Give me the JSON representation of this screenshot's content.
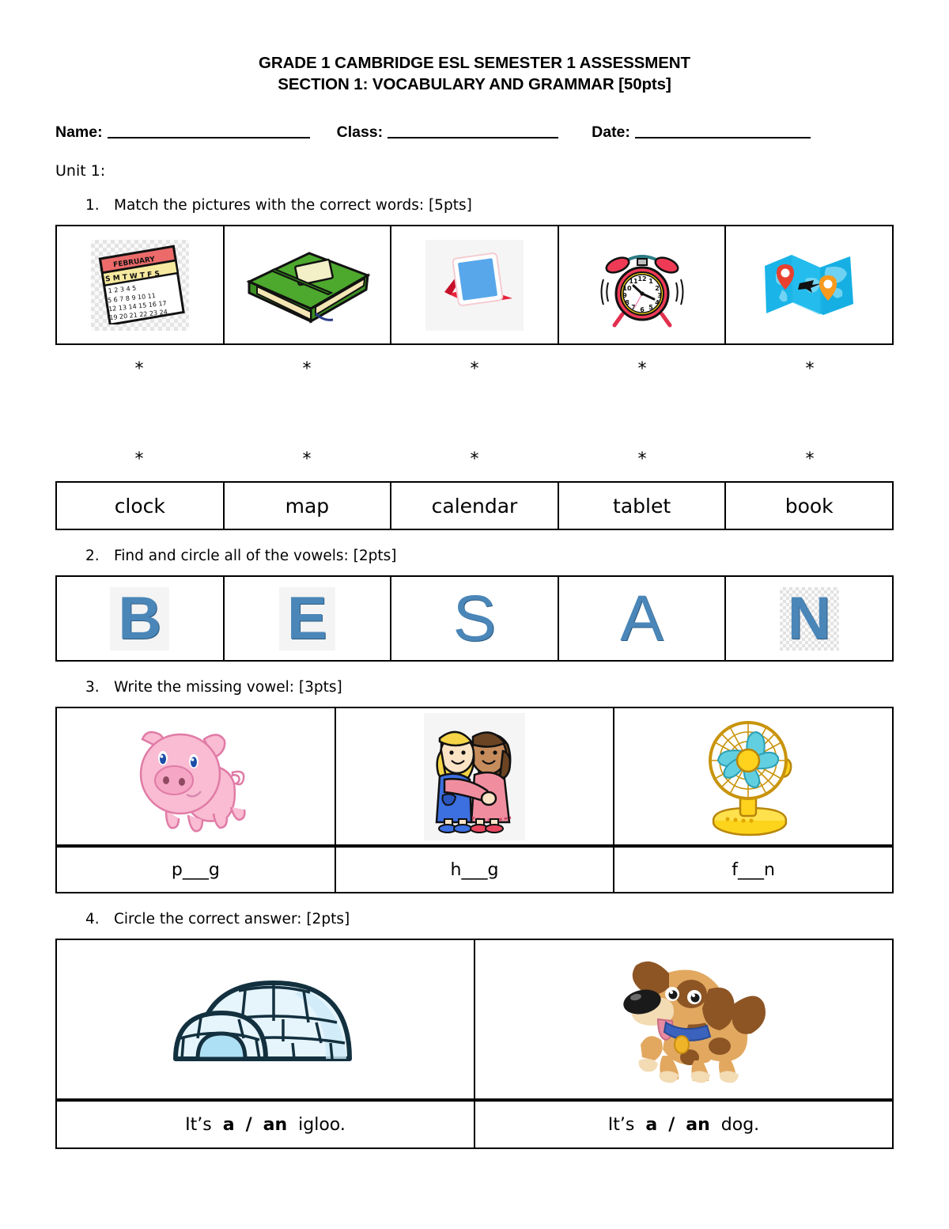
{
  "header": {
    "title_line1": "GRADE 1 CAMBRIDGE ESL SEMESTER 1 ASSESSMENT",
    "title_line2": "SECTION 1: VOCABULARY AND GRAMMAR [50pts]",
    "name_label": "Name:",
    "class_label": "Class:",
    "date_label": "Date:",
    "name_value": "",
    "class_value": "",
    "date_value": ""
  },
  "unit": {
    "label": "Unit 1:"
  },
  "questions": [
    {
      "number": "1.",
      "text": "Match the pictures with the correct words: [5pts]"
    },
    {
      "number": "2.",
      "text": "Find and circle all of the vowels: [2pts]"
    },
    {
      "number": "3.",
      "text": "Write the missing vowel: [3pts]"
    },
    {
      "number": "4.",
      "text": "Circle the correct answer: [2pts]"
    }
  ],
  "q1": {
    "pictures": [
      {
        "icon": "calendar-icon",
        "alt": "calendar",
        "month": "FEBRUARY"
      },
      {
        "icon": "book-icon",
        "alt": "book"
      },
      {
        "icon": "tablet-icon",
        "alt": "tablet"
      },
      {
        "icon": "alarm-clock-icon",
        "alt": "alarm clock"
      },
      {
        "icon": "map-icon",
        "alt": "folded world map"
      }
    ],
    "star": "*",
    "words": [
      "clock",
      "map",
      "calendar",
      "tablet",
      "book"
    ]
  },
  "q2": {
    "letters": [
      {
        "char": "B",
        "background": "light"
      },
      {
        "char": "E",
        "background": "light"
      },
      {
        "char": "S",
        "background": "none"
      },
      {
        "char": "A",
        "background": "none"
      },
      {
        "char": "N",
        "background": "checker"
      }
    ],
    "letter_color": "#4a86b8"
  },
  "q3": {
    "pictures": [
      {
        "icon": "pig-icon",
        "alt": "pig"
      },
      {
        "icon": "hug-icon",
        "alt": "two girls hugging"
      },
      {
        "icon": "fan-icon",
        "alt": "electric fan"
      }
    ],
    "answers": [
      {
        "before": "p",
        "blank": "___",
        "after": "g"
      },
      {
        "before": "h",
        "blank": "___",
        "after": "g"
      },
      {
        "before": "f",
        "blank": "___",
        "after": "n"
      }
    ]
  },
  "q4": {
    "pictures": [
      {
        "icon": "igloo-icon",
        "alt": "igloo"
      },
      {
        "icon": "dog-icon",
        "alt": "dog"
      }
    ],
    "sentences": [
      {
        "lead": "It’s",
        "option_a": "a",
        "slash": "/",
        "option_an": "an",
        "noun": "igloo."
      },
      {
        "lead": "It’s",
        "option_a": "a",
        "slash": "/",
        "option_an": "an",
        "noun": "dog."
      }
    ]
  },
  "colors": {
    "letter_blue": "#4a86b8",
    "pig_pink": "#f7b8cd",
    "fan_yellow": "#ffd21e",
    "igloo_blue": "#ddf0fa",
    "dog_tan": "#e0aa६6"
  }
}
